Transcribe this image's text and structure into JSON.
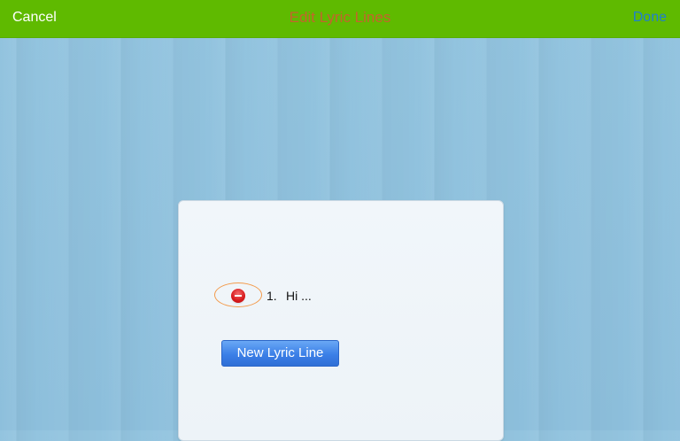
{
  "header": {
    "cancel_label": "Cancel",
    "title": "Edit Lyric Lines",
    "done_label": "Done"
  },
  "lines": [
    {
      "number": "1.",
      "text": "Hi ..."
    }
  ],
  "actions": {
    "new_line_label": "New Lyric Line"
  },
  "colors": {
    "header_bg": "#5fba00",
    "title_color": "#c5642c",
    "done_color": "#1e7fd2",
    "button_bg": "#3b7fe7",
    "delete_ring": "#f39b4b",
    "delete_icon": "#d7191c"
  },
  "icons": {
    "delete": "minus-circle-icon"
  }
}
